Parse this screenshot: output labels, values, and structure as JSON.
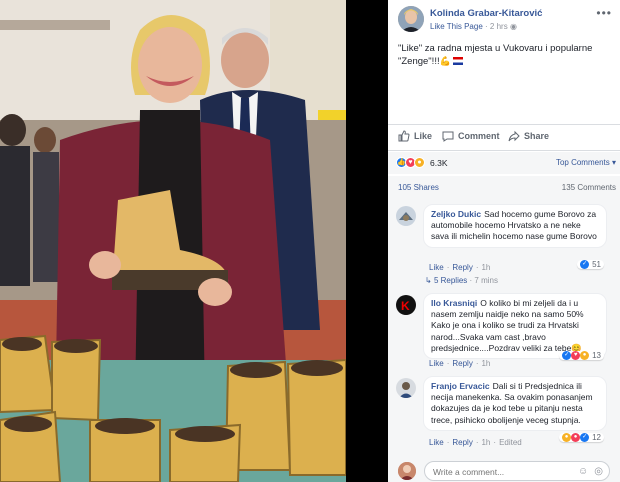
{
  "post": {
    "author": "Kolinda Grabar-Kitarović",
    "like_page": "Like This Page",
    "time": "2 hrs",
    "more": "•••",
    "text": "\"Like\" za radna mjesta u Vukovaru i popularne \"Zenge\"!!!",
    "emoji": "💪",
    "flag_icon": "croatian-flag-icon"
  },
  "actions": {
    "like": "Like",
    "comment": "Comment",
    "share": "Share"
  },
  "reactions": {
    "count": "6.3K",
    "top_comments": "Top Comments ▾",
    "shares": "105 Shares",
    "comments": "135 Comments"
  },
  "comments": [
    {
      "name": "Zeljko Dukic",
      "text": "Sad hocemo gume Borovo za automobile hocemo Hrvatsko a ne neke sava ili michelin hocemo nase gume Borovo",
      "like": "Like",
      "reply": "Reply",
      "time": "1h",
      "reactions": "51",
      "replies": "5 Replies",
      "replies_time": "7 mins"
    },
    {
      "name": "Ilo Krasniqi",
      "text": "O koliko bi mi zeljeli da i u nasem zemlju naidje neko na samo 50% Kako je ona i koliko se trudi za Hrvatski narod...Svaka vam cast ,bravo predsjednice....Pozdrav veliki za tebe😊",
      "like": "Like",
      "reply": "Reply",
      "time": "1h",
      "reactions": "13"
    },
    {
      "name": "Franjo Ervacic",
      "text": "Dali si ti Predsjednica ili necija manekenka. Sa ovakim ponasanjem dokazujes da je kod tebe u pitanju nesta trece, psihicko obolijenje veceg stupnja.",
      "like": "Like",
      "reply": "Reply",
      "time": "1h",
      "edited": "Edited",
      "reactions": "12"
    }
  ],
  "composer": {
    "placeholder": "Write a comment..."
  },
  "colors": {
    "link": "#385898",
    "panel_bg": "#f5f6f7",
    "photo_bg": "#000000"
  }
}
